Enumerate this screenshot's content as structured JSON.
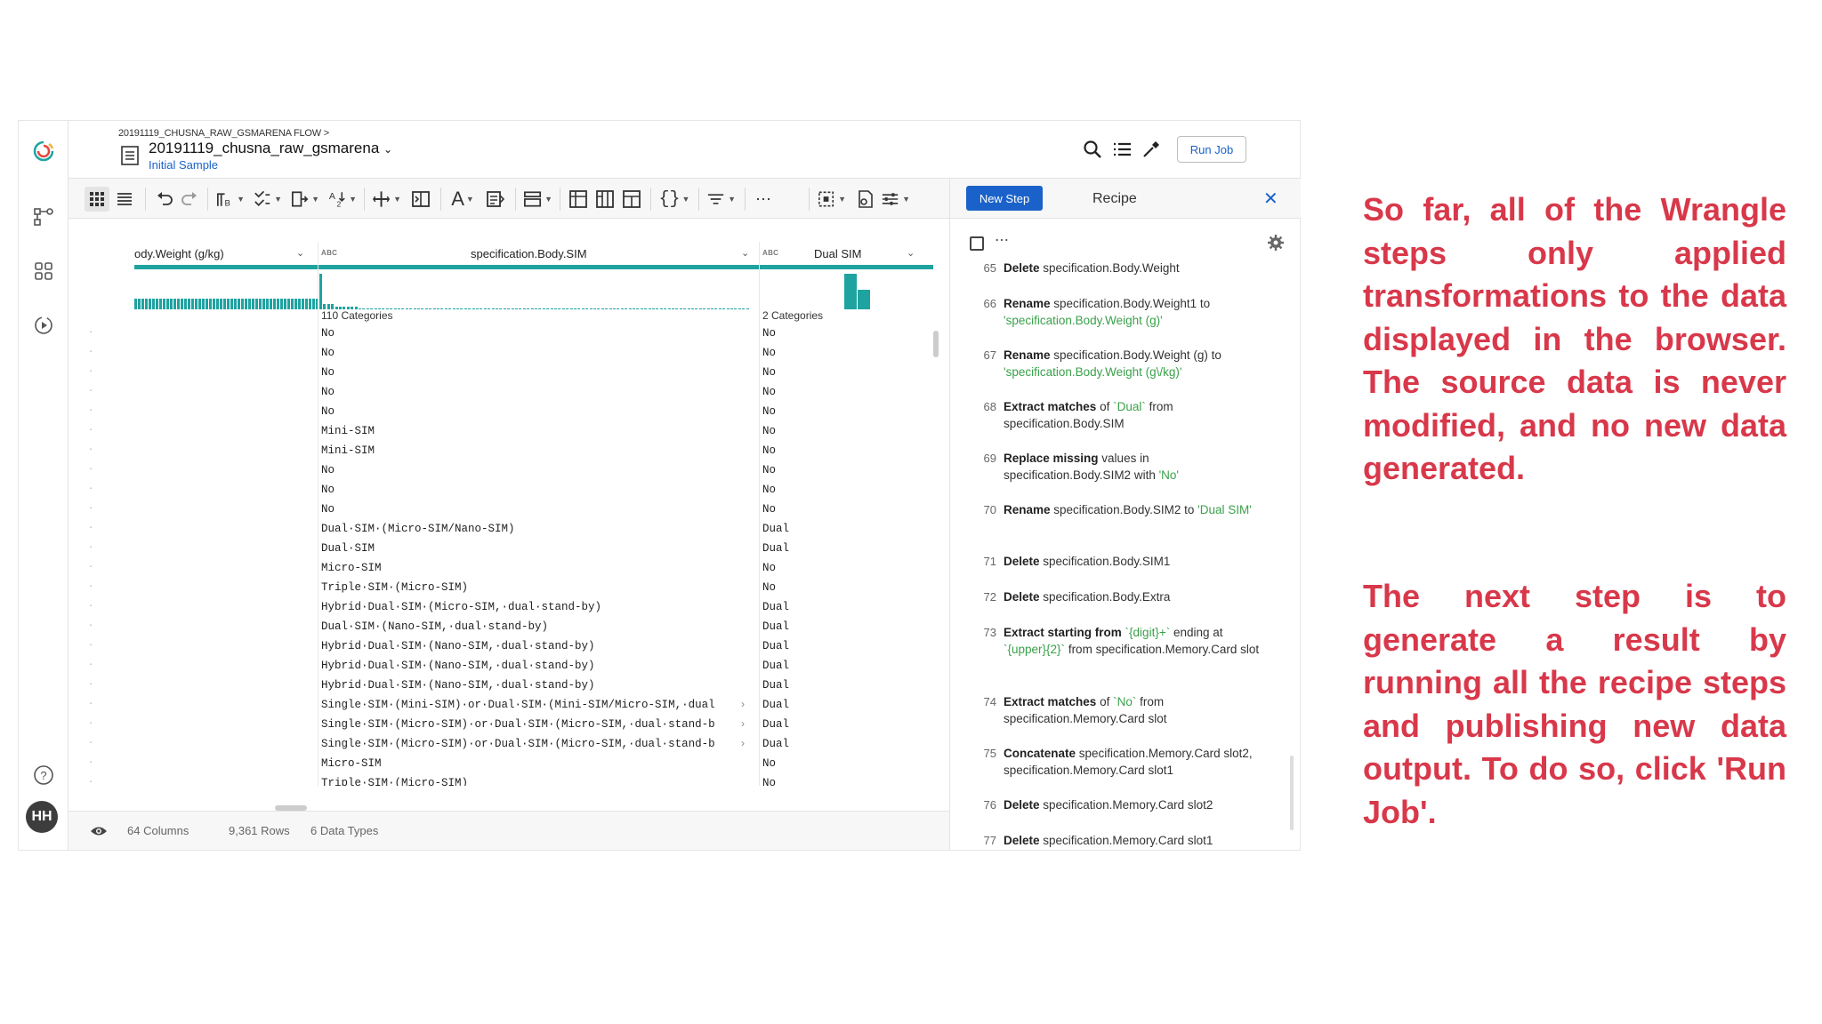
{
  "header": {
    "breadcrumb": "20191119_CHUSNA_RAW_GSMARENA FLOW >",
    "dataset_title": "20191119_chusna_raw_gsmarena",
    "sample_link": "Initial Sample",
    "run_job_label": "Run Job"
  },
  "avatar_initials": "HH",
  "recipe": {
    "new_step_label": "New Step",
    "title": "Recipe",
    "steps": [
      {
        "num": "65",
        "parts": [
          [
            "kw",
            "Delete"
          ],
          [
            "t",
            " specification.Body.Weight"
          ]
        ]
      },
      {
        "num": "66",
        "parts": [
          [
            "kw",
            "Rename"
          ],
          [
            "t",
            " specification.Body.Weight1 to "
          ],
          [
            "lit",
            "'specification.Body.Weight (g)'"
          ]
        ]
      },
      {
        "num": "67",
        "parts": [
          [
            "kw",
            "Rename"
          ],
          [
            "t",
            " specification.Body.Weight (g) to "
          ],
          [
            "lit",
            "'specification.Body.Weight (g\\/kg)'"
          ]
        ]
      },
      {
        "num": "68",
        "parts": [
          [
            "kw",
            "Extract matches"
          ],
          [
            "t",
            " of "
          ],
          [
            "lit",
            "`Dual`"
          ],
          [
            "t",
            " from specification.Body.SIM"
          ]
        ]
      },
      {
        "num": "69",
        "parts": [
          [
            "kw",
            "Replace missing"
          ],
          [
            "t",
            " values in specification.Body.SIM2 with "
          ],
          [
            "lit",
            "'No'"
          ]
        ]
      },
      {
        "num": "70",
        "parts": [
          [
            "kw",
            "Rename"
          ],
          [
            "t",
            " specification.Body.SIM2 to "
          ],
          [
            "lit",
            "'Dual SIM'"
          ]
        ]
      },
      {
        "num": "71",
        "parts": [
          [
            "kw",
            "Delete"
          ],
          [
            "t",
            " specification.Body.SIM1"
          ]
        ]
      },
      {
        "num": "72",
        "parts": [
          [
            "kw",
            "Delete"
          ],
          [
            "t",
            " specification.Body.Extra"
          ]
        ]
      },
      {
        "num": "73",
        "parts": [
          [
            "kw",
            "Extract starting from"
          ],
          [
            "t",
            " "
          ],
          [
            "lit",
            "`{digit}+`"
          ],
          [
            "t",
            " ending at "
          ],
          [
            "lit",
            "`{upper}{2}`"
          ],
          [
            "t",
            " from specification.Memory.Card slot"
          ]
        ]
      },
      {
        "num": "74",
        "parts": [
          [
            "kw",
            "Extract matches"
          ],
          [
            "t",
            " of "
          ],
          [
            "lit",
            "`No`"
          ],
          [
            "t",
            " from specification.Memory.Card slot"
          ]
        ]
      },
      {
        "num": "75",
        "parts": [
          [
            "kw",
            "Concatenate"
          ],
          [
            "t",
            " specification.Memory.Card slot2, specification.Memory.Card slot1"
          ]
        ]
      },
      {
        "num": "76",
        "parts": [
          [
            "kw",
            "Delete"
          ],
          [
            "t",
            " specification.Memory.Card slot2"
          ]
        ]
      },
      {
        "num": "77",
        "parts": [
          [
            "kw",
            "Delete"
          ],
          [
            "t",
            " specification.Memory.Card slot1"
          ]
        ]
      }
    ]
  },
  "grid": {
    "columns": [
      {
        "name": "ody.Weight (g/kg)",
        "type": ""
      },
      {
        "name": "specification.Body.SIM",
        "type": "ABC",
        "categories": "110 Categories"
      },
      {
        "name": "Dual SIM",
        "type": "ABC",
        "categories": "2 Categories"
      }
    ],
    "rows": [
      {
        "sim": "No",
        "dual": "No"
      },
      {
        "sim": "No",
        "dual": "No"
      },
      {
        "sim": "No",
        "dual": "No"
      },
      {
        "sim": "No",
        "dual": "No"
      },
      {
        "sim": "No",
        "dual": "No"
      },
      {
        "sim": "Mini-SIM",
        "dual": "No"
      },
      {
        "sim": "Mini-SIM",
        "dual": "No"
      },
      {
        "sim": "No",
        "dual": "No"
      },
      {
        "sim": "No",
        "dual": "No"
      },
      {
        "sim": "No",
        "dual": "No"
      },
      {
        "sim": "Dual·SIM·(Micro-SIM/Nano-SIM)",
        "dual": "Dual"
      },
      {
        "sim": "Dual·SIM",
        "dual": "Dual"
      },
      {
        "sim": "Micro-SIM",
        "dual": "No"
      },
      {
        "sim": "Triple·SIM·(Micro-SIM)",
        "dual": "No"
      },
      {
        "sim": "Hybrid·Dual·SIM·(Micro-SIM,·dual·stand-by)",
        "dual": "Dual"
      },
      {
        "sim": "Dual·SIM·(Nano-SIM,·dual·stand-by)",
        "dual": "Dual"
      },
      {
        "sim": "Hybrid·Dual·SIM·(Nano-SIM,·dual·stand-by)",
        "dual": "Dual"
      },
      {
        "sim": "Hybrid·Dual·SIM·(Nano-SIM,·dual·stand-by)",
        "dual": "Dual"
      },
      {
        "sim": "Hybrid·Dual·SIM·(Nano-SIM,·dual·stand-by)",
        "dual": "Dual"
      },
      {
        "sim": "Single·SIM·(Mini-SIM)·or·Dual·SIM·(Mini-SIM/Micro-SIM,·dual",
        "dual": "Dual"
      },
      {
        "sim": "Single·SIM·(Micro-SIM)·or·Dual·SIM·(Micro-SIM,·dual·stand-b",
        "dual": "Dual"
      },
      {
        "sim": "Single·SIM·(Micro-SIM)·or·Dual·SIM·(Micro-SIM,·dual·stand-b",
        "dual": "Dual"
      },
      {
        "sim": "Micro-SIM",
        "dual": "No"
      },
      {
        "sim": "Triple·SIM·(Micro-SIM)",
        "dual": "No"
      }
    ]
  },
  "footer": {
    "columns": "64 Columns",
    "rows": "9,361 Rows",
    "types": "6 Data Types"
  },
  "notes": {
    "note1": "So far, all of the Wrangle steps only applied transformations to the data displayed in the browser. The source data is never modified, and no new data generated.",
    "note2": "The next step is to generate a result by running all the recipe steps and publishing new data output. To do so, click 'Run Job'."
  },
  "colors": {
    "accent": "#1a62c9",
    "teal": "#1fa3a0",
    "note_red": "#d8384a",
    "literal_green": "#3aa14a"
  }
}
